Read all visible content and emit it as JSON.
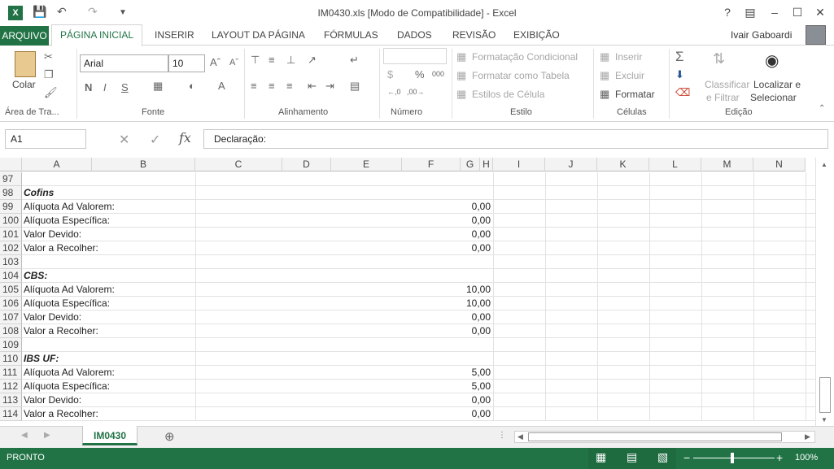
{
  "window": {
    "title": "IM0430.xls  [Modo de Compatibilidade] - Excel",
    "help": "?",
    "user": "Ivair Gaboardi"
  },
  "tabs": {
    "file": "ARQUIVO",
    "home": "PÁGINA INICIAL",
    "items": [
      "INSERIR",
      "LAYOUT DA PÁGINA",
      "FÓRMULAS",
      "DADOS",
      "REVISÃO",
      "EXIBIÇÃO"
    ]
  },
  "ribbon": {
    "paste": "Colar",
    "font_name": "Arial",
    "font_size": "10",
    "bold": "N",
    "italic": "I",
    "underline": "S",
    "cond_format": "Formatação Condicional",
    "format_table": "Formatar como Tabela",
    "cell_styles": "Estilos de Célula",
    "insert": "Inserir",
    "delete": "Excluir",
    "format": "Formatar",
    "sort_filter_1": "Classificar",
    "sort_filter_2": "e Filtrar",
    "find_1": "Localizar e",
    "find_2": "Selecionar",
    "groups": [
      "Área de Tra...",
      "Fonte",
      "Alinhamento",
      "Número",
      "Estilo",
      "Células",
      "Edição"
    ]
  },
  "formula_bar": {
    "name_box": "A1",
    "fx": "fx",
    "content": "Declaração:"
  },
  "grid": {
    "columns": [
      "A",
      "B",
      "C",
      "D",
      "E",
      "F",
      "G",
      "H",
      "I",
      "J",
      "K",
      "L",
      "M",
      "N"
    ],
    "rows": [
      {
        "num": "97",
        "label": "",
        "value": "",
        "bold": false
      },
      {
        "num": "98",
        "label": "Cofins",
        "value": "",
        "bold": true
      },
      {
        "num": "99",
        "label": "Alíquota Ad Valorem:",
        "value": "0,00",
        "bold": false
      },
      {
        "num": "100",
        "label": "Alíquota Específica:",
        "value": "0,00",
        "bold": false
      },
      {
        "num": "101",
        "label": "Valor Devido:",
        "value": "0,00",
        "bold": false
      },
      {
        "num": "102",
        "label": "Valor a Recolher:",
        "value": "0,00",
        "bold": false
      },
      {
        "num": "103",
        "label": "",
        "value": "",
        "bold": false
      },
      {
        "num": "104",
        "label": "CBS:",
        "value": "",
        "bold": true
      },
      {
        "num": "105",
        "label": "Alíquota Ad Valorem:",
        "value": "10,00",
        "bold": false
      },
      {
        "num": "106",
        "label": "Alíquota Específica:",
        "value": "10,00",
        "bold": false
      },
      {
        "num": "107",
        "label": "Valor Devido:",
        "value": "0,00",
        "bold": false
      },
      {
        "num": "108",
        "label": "Valor a Recolher:",
        "value": "0,00",
        "bold": false
      },
      {
        "num": "109",
        "label": "",
        "value": "",
        "bold": false
      },
      {
        "num": "110",
        "label": "IBS UF:",
        "value": "",
        "bold": true
      },
      {
        "num": "111",
        "label": "Alíquota Ad Valorem:",
        "value": "5,00",
        "bold": false
      },
      {
        "num": "112",
        "label": "Alíquota Específica:",
        "value": "5,00",
        "bold": false
      },
      {
        "num": "113",
        "label": "Valor Devido:",
        "value": "0,00",
        "bold": false
      },
      {
        "num": "114",
        "label": "Valor a Recolher:",
        "value": "0,00",
        "bold": false
      }
    ]
  },
  "sheets": {
    "active": "IM0430"
  },
  "status": {
    "mode": "PRONTO",
    "zoom": "100%"
  },
  "colors": {
    "accent": "#217346"
  }
}
